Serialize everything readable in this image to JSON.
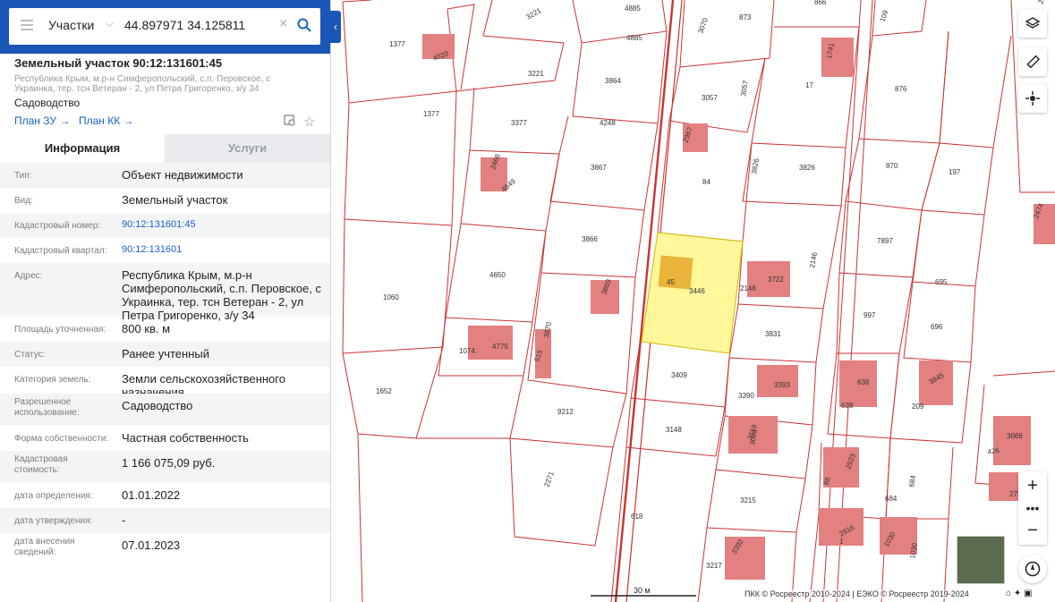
{
  "search": {
    "type": "Участки",
    "coords": "44.897971 34.125811"
  },
  "object": {
    "title": "Земельный участок 90:12:131601:45",
    "address_small": "Республика Крым, м.р-н Симферопольский, с.п. Перовское, с Украинка, тер. тсн Ветеран - 2, ул Петра Григоренко, з/у 34",
    "purpose": "Садоводство",
    "link_plan_zu": "План ЗУ →",
    "link_plan_kk": "План КК →"
  },
  "tabs": {
    "info": "Информация",
    "services": "Услуги"
  },
  "rows": [
    {
      "label": "Тип:",
      "value": "Объект недвижимости"
    },
    {
      "label": "Вид:",
      "value": "Земельный участок"
    },
    {
      "label": "Кадастровый номер:",
      "value": "90:12:131601:45",
      "link": true
    },
    {
      "label": "Кадастровый квартал:",
      "value": "90:12:131601",
      "link": true
    },
    {
      "label": "Адрес:",
      "value": "Республика Крым, м.р-н Симферопольский, с.п. Перовское, с Украинка, тер. тсн Ветеран - 2, ул Петра Григоренко, з/у 34"
    },
    {
      "label": "Площадь уточненная:",
      "value": "800 кв. м"
    },
    {
      "label": "Статус:",
      "value": "Ранее учтенный"
    },
    {
      "label": "Категория земель:",
      "value": "Земли сельскохозяйственного назначения"
    },
    {
      "label": "Разрешенное использование:",
      "value": "Садоводство"
    },
    {
      "label": "Форма собственности:",
      "value": "Частная собственность"
    },
    {
      "label": "Кадастровая стоимость:",
      "value": "1 166 075,09 руб."
    },
    {
      "label": "дата определения:",
      "value": "01.01.2022"
    },
    {
      "label": "дата утверждения:",
      "value": "-"
    },
    {
      "label": "дата внесения сведений:",
      "value": "07.01.2023"
    }
  ],
  "map": {
    "labels": [
      "4885",
      "3221",
      "873",
      "3070",
      "866",
      "109",
      "2170",
      "1377",
      "4020",
      "4885",
      "3221",
      "3864",
      "3057",
      "3057",
      "1741",
      "17",
      "876",
      "1377",
      "3377",
      "4248",
      "2967",
      "84",
      "3826",
      "3826",
      "870",
      "197",
      "2468",
      "4649",
      "3867",
      "3866",
      "7897",
      "2474",
      "4650",
      "1060",
      "3869",
      "2146",
      "3722",
      "2146",
      "695",
      "997",
      "696",
      "1074",
      "4775",
      "515",
      "3870",
      "3831",
      "3409",
      "3390",
      "3393",
      "638",
      "638",
      "209",
      "3945",
      "1652",
      "9212",
      "3148",
      "3119",
      "3089",
      "426",
      "3066",
      "2271",
      "618",
      "3215",
      "2923",
      "88",
      "684",
      "684",
      "272",
      "3217",
      "3392",
      "2916",
      "1",
      "1030",
      "1030",
      "3446",
      "45",
      "3104"
    ],
    "scale_label": "30 м",
    "attribution": "ПКК © Росреестр 2010-2024 | ЕЭКО © Росреестр 2019-2024"
  },
  "colors": {
    "header": "#1a56b6",
    "link": "#1a63c6",
    "parcel_line": "#cc2222",
    "selected_fill": "#fff79a",
    "building": "#e38080"
  }
}
